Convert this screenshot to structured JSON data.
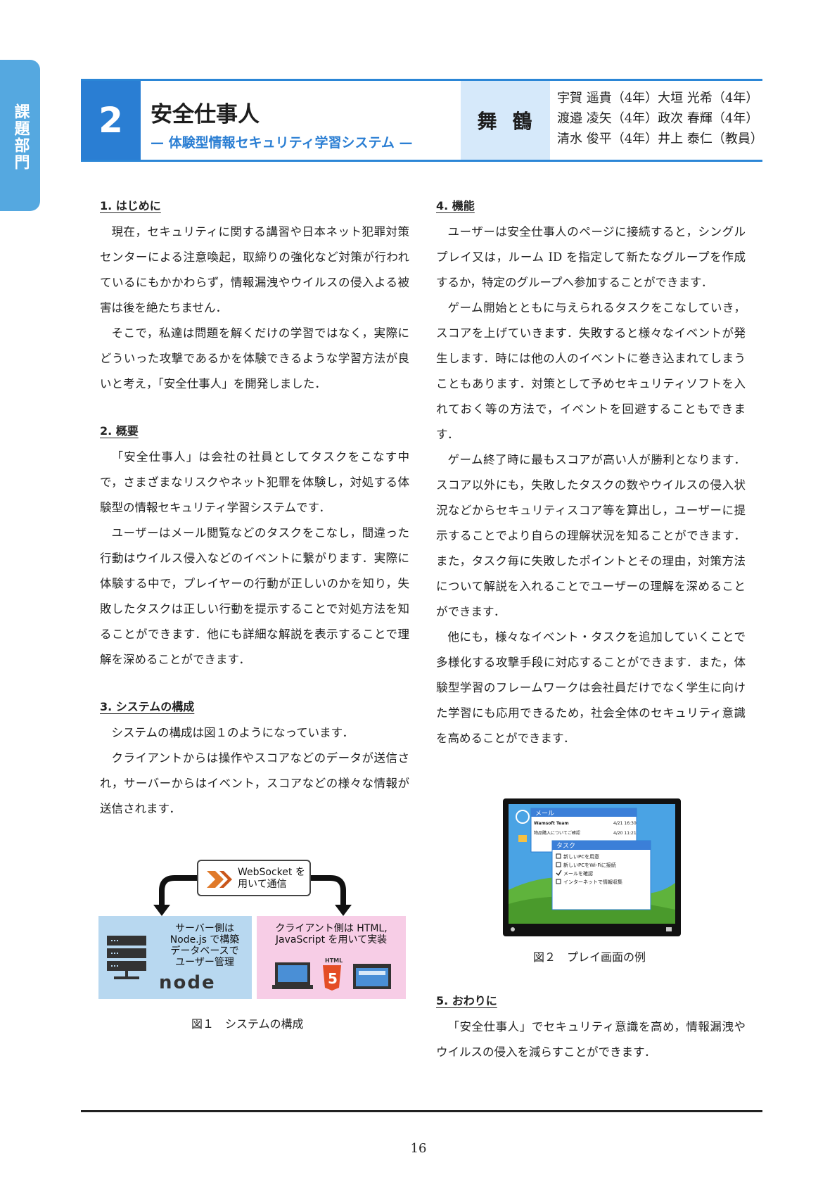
{
  "side_tab": "課題部門",
  "header": {
    "number": "2",
    "title": "安全仕事人",
    "subtitle": "— 体験型情報セキュリティ学習システム —",
    "school": "舞鶴",
    "members": [
      "宇賀 遥貴（4年）大垣 光希（4年）",
      "渡邉 凌矢（4年）政次 春輝（4年）",
      "清水 俊平（4年）井上 泰仁（教員）"
    ]
  },
  "sections": {
    "s1": {
      "heading": "1. はじめに",
      "paragraphs": [
        "現在，セキュリティに関する講習や日本ネット犯罪対策センターによる注意喚起，取締りの強化など対策が行われているにもかかわらず，情報漏洩やウイルスの侵入よる被害は後を絶たちません．",
        "そこで，私達は問題を解くだけの学習ではなく，実際にどういった攻撃であるかを体験できるような学習方法が良いと考え，「安全仕事人」を開発しました．"
      ]
    },
    "s2": {
      "heading": "2. 概要",
      "paragraphs": [
        "「安全仕事人」は会社の社員としてタスクをこなす中で，さまざまなリスクやネット犯罪を体験し，対処する体験型の情報セキュリティ学習システムです．",
        "ユーザーはメール閲覧などのタスクをこなし，間違った行動はウイルス侵入などのイベントに繋がります．実際に体験する中で，プレイヤーの行動が正しいのかを知り，失敗したタスクは正しい行動を提示することで対処方法を知ることができます．他にも詳細な解説を表示することで理解を深めることができます．"
      ]
    },
    "s3": {
      "heading": "3. システムの構成",
      "paragraphs": [
        "システムの構成は図１のようになっています．",
        "クライアントからは操作やスコアなどのデータが送信され，サーバーからはイベント，スコアなどの様々な情報が送信されます．"
      ]
    },
    "s4": {
      "heading": "4. 機能",
      "paragraphs": [
        "ユーザーは安全仕事人のページに接続すると，シングルプレイ又は，ルーム ID を指定して新たなグループを作成するか，特定のグループへ参加することができます．",
        "ゲーム開始とともに与えられるタスクをこなしていき，スコアを上げていきます．失敗すると様々なイベントが発生します．時には他の人のイベントに巻き込まれてしまうこともあります．対策として予めセキュリティソフトを入れておく等の方法で，イベントを回避することもできます．",
        "ゲーム終了時に最もスコアが高い人が勝利となります．スコア以外にも，失敗したタスクの数やウイルスの侵入状況などからセキュリティスコア等を算出し，ユーザーに提示することでより自らの理解状況を知ることができます．また，タスク毎に失敗したポイントとその理由，対策方法について解説を入れることでユーザーの理解を深めることができます．",
        "他にも，様々なイベント・タスクを追加していくことで多様化する攻撃手段に対応することができます．また，体験型学習のフレームワークは会社員だけでなく学生に向けた学習にも応用できるため，社会全体のセキュリティ意識を高めることができます．"
      ]
    },
    "s5": {
      "heading": "5. おわりに",
      "paragraphs": [
        "「安全仕事人」でセキュリティ意識を高め，情報漏洩やウイルスの侵入を減らすことができます．"
      ]
    }
  },
  "figure1": {
    "websocket_line1": "WebSocket を",
    "websocket_line2": "用いて通信",
    "server_lines": [
      "サーバー側は",
      "Node.js で構築",
      "データベースで",
      "ユーザー管理"
    ],
    "client_lines": [
      "クライアント側は HTML,",
      "JavaScript を用いて実装"
    ],
    "node_logo": "node",
    "html_label": "HTML",
    "caption": "図１　システムの構成"
  },
  "figure2": {
    "mail_title": "メール",
    "mail_row1_from": "Wamsoft Team",
    "mail_row1_date": "4/21 16:30",
    "mail_row2_subject": "物品購入についてご確認",
    "mail_row2_date": "4/20 11:21",
    "task_title": "タスク",
    "tasks": [
      "新しいPCを用意",
      "新しいPCをWi-Fiに接続",
      "メールを確認",
      "インターネットで情報収集"
    ],
    "caption": "図２　プレイ画面の例"
  },
  "page_number": "16",
  "colors": {
    "accent": "#2a7ed3",
    "tab": "#55a8e0",
    "school_bg": "#d6e9fa",
    "server_bg": "#b8d8f0",
    "client_bg": "#f7cde6"
  }
}
